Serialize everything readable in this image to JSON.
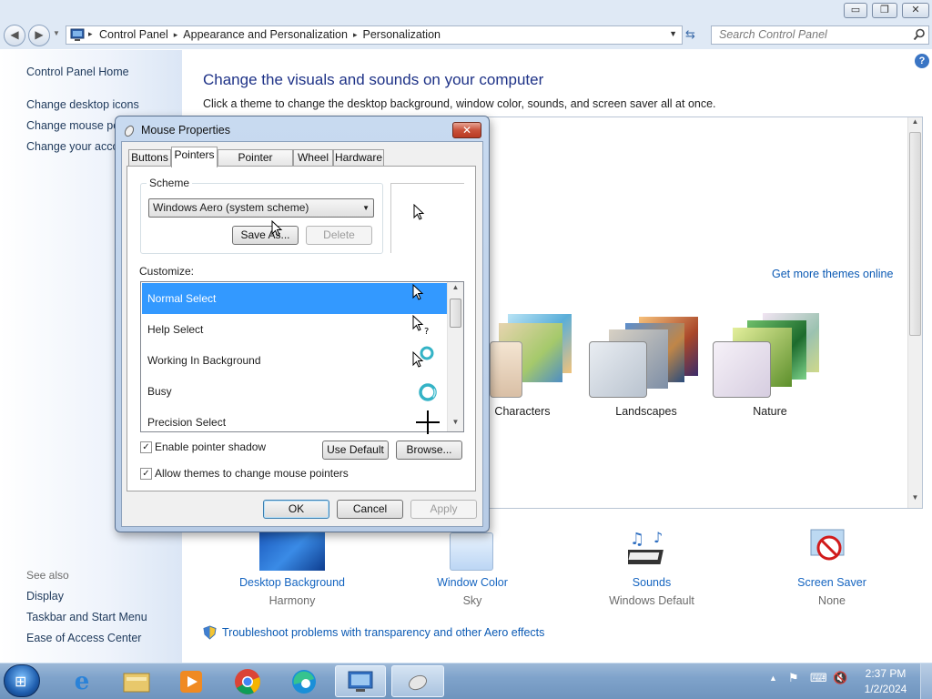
{
  "window": {
    "minimize_glyph": "▭",
    "restore_glyph": "❐",
    "close_glyph": "✕"
  },
  "address": {
    "items": [
      "Control Panel",
      "Appearance and Personalization",
      "Personalization"
    ],
    "separator": "▸",
    "search_placeholder": "Search Control Panel"
  },
  "sidebar": {
    "home": "Control Panel Home",
    "links": [
      "Change desktop icons",
      "Change mouse po",
      "Change your acco"
    ],
    "see_also_title": "See also",
    "see_also": [
      "Display",
      "Taskbar and Start Menu",
      "Ease of Access Center"
    ]
  },
  "main": {
    "heading": "Change the visuals and sounds on your computer",
    "description": "Click a theme to change the desktop background, window color, sounds, and screen saver all at once.",
    "get_more": "Get more themes online",
    "themes": [
      "Characters",
      "Landscapes",
      "Nature"
    ],
    "settings": [
      {
        "label": "Desktop Background",
        "value": "Harmony"
      },
      {
        "label": "Window Color",
        "value": "Sky"
      },
      {
        "label": "Sounds",
        "value": "Windows Default"
      },
      {
        "label": "Screen Saver",
        "value": "None"
      }
    ],
    "troubleshoot": "Troubleshoot problems with transparency and other Aero effects"
  },
  "dialog": {
    "title": "Mouse Properties",
    "tabs": [
      "Buttons",
      "Pointers",
      "Pointer Options",
      "Wheel",
      "Hardware"
    ],
    "active_tab": "Pointers",
    "scheme_label": "Scheme",
    "scheme_value": "Windows Aero (system scheme)",
    "save_as": "Save As...",
    "delete": "Delete",
    "customize_label": "Customize:",
    "cursor_rows": [
      "Normal Select",
      "Help Select",
      "Working In Background",
      "Busy",
      "Precision Select"
    ],
    "selected_row": "Normal Select",
    "enable_shadow": "Enable pointer shadow",
    "enable_shadow_checked": true,
    "allow_themes": "Allow themes to change mouse pointers",
    "allow_themes_checked": true,
    "use_default": "Use Default",
    "browse": "Browse...",
    "ok": "OK",
    "cancel": "Cancel",
    "apply": "Apply"
  },
  "taskbar": {
    "time": "2:37 PM",
    "date": "1/2/2024",
    "items": [
      "start-orb",
      "internet-explorer",
      "file-explorer",
      "media-player",
      "chrome",
      "edge",
      "control-panel",
      "mouse-properties"
    ]
  },
  "colors": {
    "link": "#1e395b",
    "heading": "#1e3287",
    "selection": "#3399ff"
  }
}
